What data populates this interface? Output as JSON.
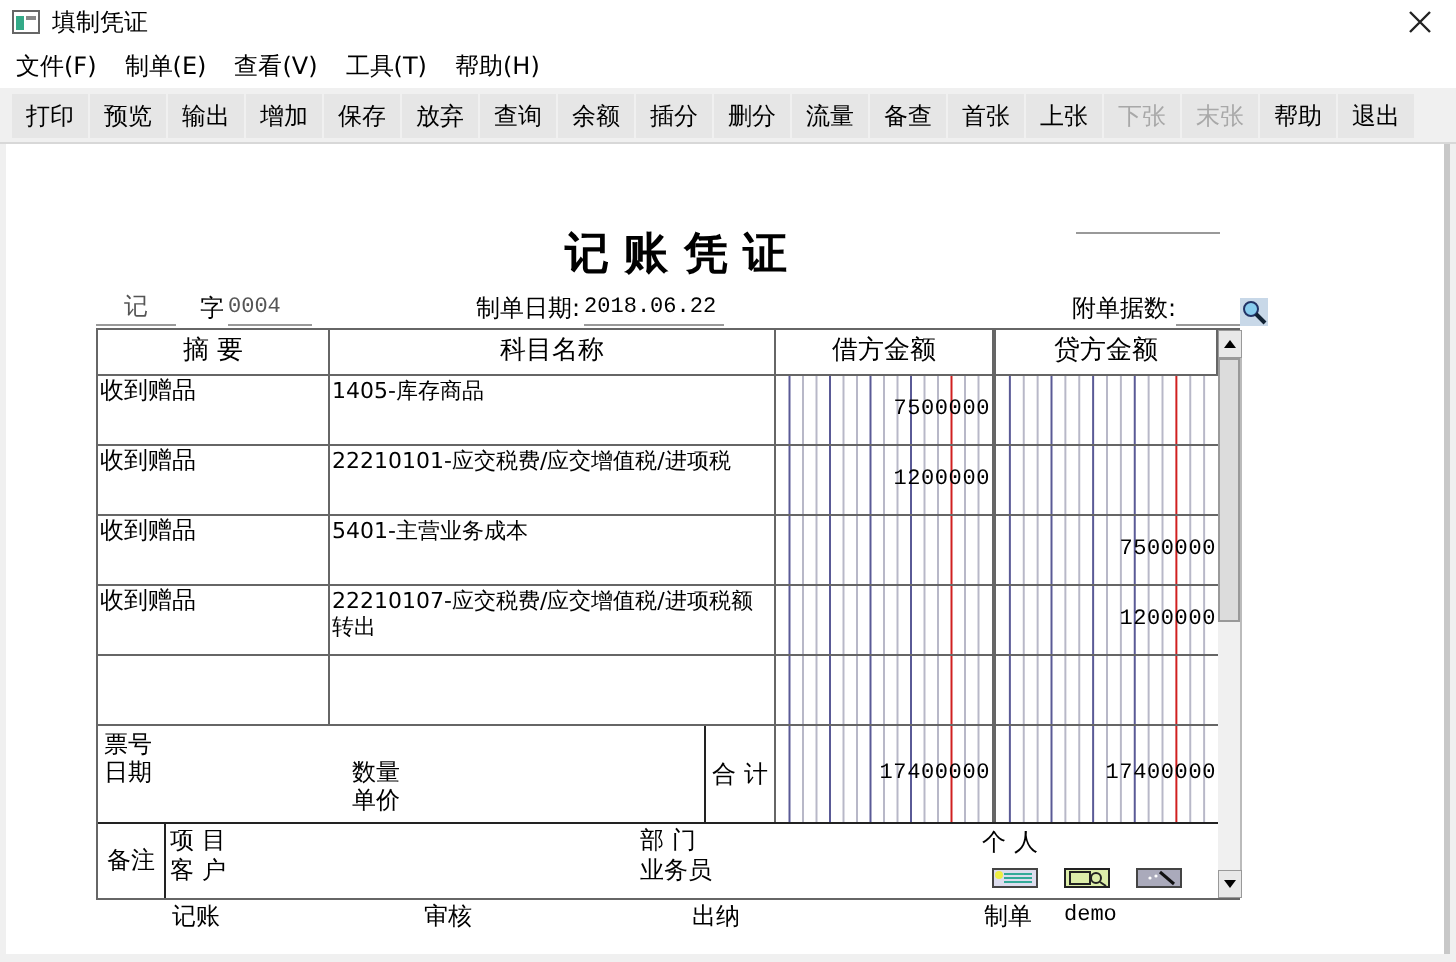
{
  "window": {
    "title": "填制凭证"
  },
  "menu": [
    {
      "label": "文件(F)"
    },
    {
      "label": "制单(E)"
    },
    {
      "label": "查看(V)"
    },
    {
      "label": "工具(T)"
    },
    {
      "label": "帮助(H)"
    }
  ],
  "toolbar": [
    {
      "label": "打印",
      "disabled": false
    },
    {
      "label": "预览",
      "disabled": false
    },
    {
      "label": "输出",
      "disabled": false
    },
    {
      "label": "增加",
      "disabled": false
    },
    {
      "label": "保存",
      "disabled": false
    },
    {
      "label": "放弃",
      "disabled": false
    },
    {
      "label": "查询",
      "disabled": false
    },
    {
      "label": "余额",
      "disabled": false
    },
    {
      "label": "插分",
      "disabled": false
    },
    {
      "label": "删分",
      "disabled": false
    },
    {
      "label": "流量",
      "disabled": false
    },
    {
      "label": "备查",
      "disabled": false
    },
    {
      "label": "首张",
      "disabled": false
    },
    {
      "label": "上张",
      "disabled": false
    },
    {
      "label": "下张",
      "disabled": true
    },
    {
      "label": "末张",
      "disabled": true
    },
    {
      "label": "帮助",
      "disabled": false
    },
    {
      "label": "退出",
      "disabled": false
    }
  ],
  "voucher": {
    "title": "记 账 凭 证",
    "type": "记",
    "zi_label": "字",
    "number": "0004",
    "date_label": "制单日期:",
    "date": "2018.06.22",
    "attachments_label": "附单据数:"
  },
  "columns": [
    "摘 要",
    "科目名称",
    "借方金额",
    "贷方金额"
  ],
  "rows": [
    {
      "summary": "收到赠品",
      "account": "1405-库存商品",
      "debit": "7500000"
    },
    {
      "summary": "收到赠品",
      "account": "22210101-应交税费/应交增值税/进项税",
      "debit": "1200000"
    },
    {
      "summary": "收到赠品",
      "account": "5401-主营业务成本",
      "credit": "7500000"
    },
    {
      "summary": "收到赠品",
      "account": "22210107-应交税费/应交增值税/进项税额转出",
      "credit": "1200000"
    }
  ],
  "totals": {
    "ticket_label": "票号",
    "date_label": "日期",
    "quantity_label": "数量",
    "price_label": "单价",
    "total_label": "合 计",
    "debit": "17400000",
    "credit": "17400000"
  },
  "notes": {
    "label": "备注",
    "project_label": "项 目",
    "customer_label": "客 户",
    "department_label": "部 门",
    "salesperson_label": "业务员",
    "person_label": "个 人"
  },
  "signatures": [
    {
      "label": "记账"
    },
    {
      "label": "审核"
    },
    {
      "label": "出纳"
    },
    {
      "label": "制单",
      "value": "demo"
    }
  ]
}
